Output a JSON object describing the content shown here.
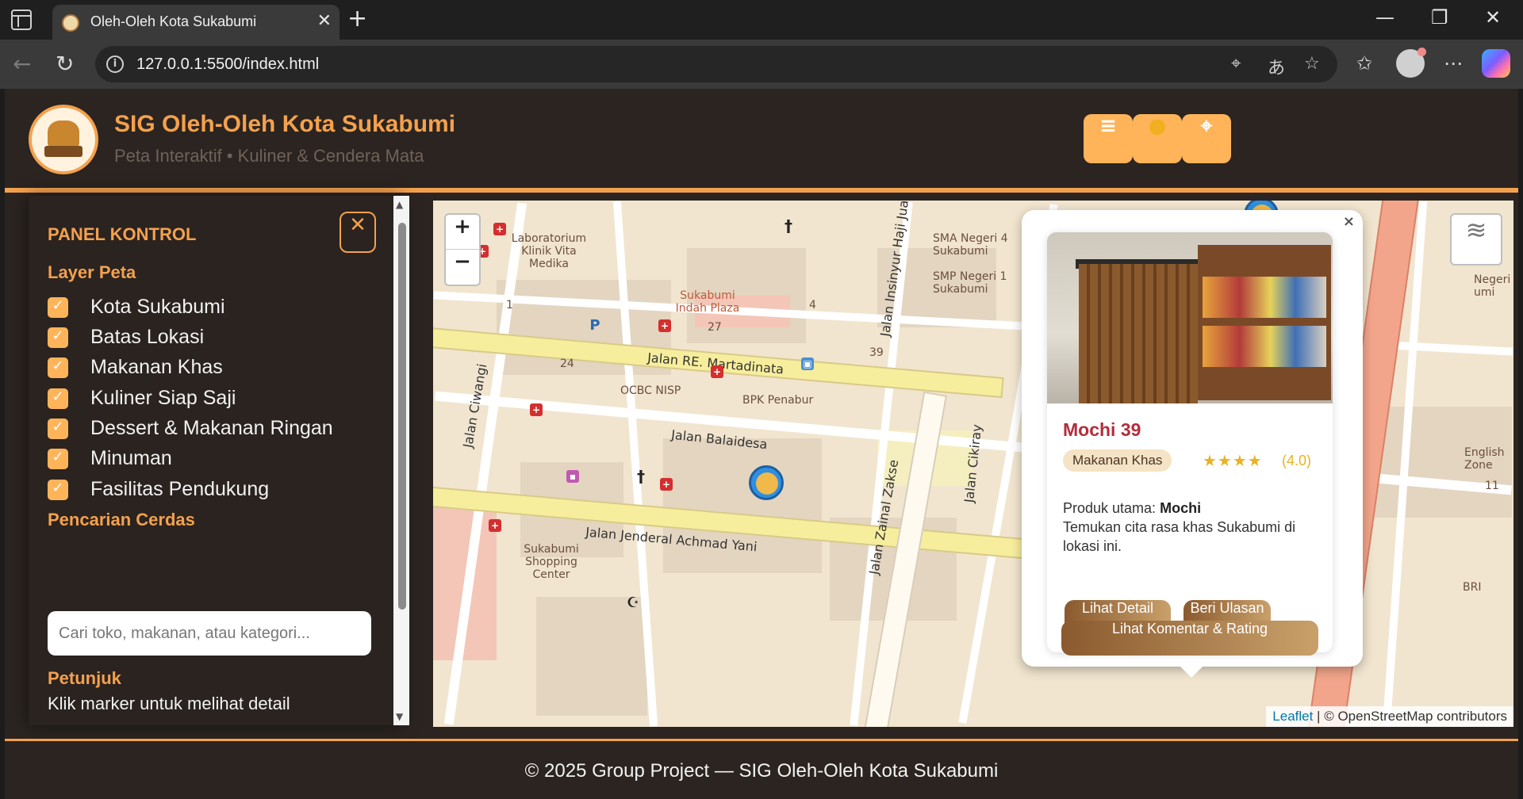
{
  "browser": {
    "tab_title": "Oleh-Oleh Kota Sukabumi",
    "tab_close": "✕",
    "new_tab": "+",
    "url": "127.0.0.1:5500/index.html",
    "window_controls": {
      "minimize": "—",
      "restore": "❐",
      "close": "✕"
    },
    "nav": {
      "back": "←",
      "reload": "↻",
      "info": "i"
    },
    "addr_icons": {
      "location": "⌖",
      "read_aloud": "あ",
      "favorite": "☆"
    },
    "toolbar_icons": {
      "favorites": "✩",
      "more": "⋯"
    }
  },
  "header": {
    "title": "SIG Oleh-Oleh Kota Sukabumi",
    "subtitle": "Peta Interaktif • Kuliner & Cendera Mata",
    "buttons": {
      "menu": "≡",
      "theme": "●",
      "locate": "⌖"
    }
  },
  "panel": {
    "title": "PANEL KONTROL",
    "close": "✕",
    "layer_heading": "Layer Peta",
    "layers": [
      {
        "label": "Kota Sukabumi",
        "checked": true
      },
      {
        "label": "Batas Lokasi",
        "checked": true
      },
      {
        "label": "Makanan Khas",
        "checked": true
      },
      {
        "label": "Kuliner Siap Saji",
        "checked": true
      },
      {
        "label": "Dessert & Makanan Ringan",
        "checked": true
      },
      {
        "label": "Minuman",
        "checked": true
      },
      {
        "label": "Fasilitas Pendukung",
        "checked": true
      }
    ],
    "check_mark": "✓",
    "search_heading": "Pencarian Cerdas",
    "search_placeholder": "Cari toko, makanan, atau kategori...",
    "hint_heading": "Petunjuk",
    "hint_text": "Klik marker untuk melihat detail"
  },
  "map": {
    "zoom_in": "+",
    "zoom_out": "−",
    "layers_icon": "≋",
    "streets": {
      "martadinata": "Jalan RE. Martadinata",
      "balaidesa": "Jalan Balaidesa",
      "ahmad_yani": "Jalan Jenderal Achmad Yani",
      "ciwangi": "Jalan Ciwangi",
      "zainal_zakse": "Jalan Zainal Zakse",
      "cikiray": "Jalan Cikiray",
      "insinyur": "Jalan Insinyur Haji Juanda"
    },
    "places": {
      "lab": "Laboratorium Klinik Vita Medika",
      "plaza": "Sukabumi Indah Plaza",
      "smp": "SMP Negeri 1 Sukabumi",
      "sma": "SMA Negeri 4 Sukabumi",
      "ocbc": "OCBC NISP",
      "bpk": "BPK Penabur",
      "mall": "Sukabumi Shopping Center",
      "english": "English Zone",
      "negeri": "Negeri umi",
      "bri": "BRI"
    },
    "house_numbers": [
      "24",
      "27",
      "39",
      "4",
      "1",
      "11"
    ],
    "attribution": {
      "leaflet": "Leaflet",
      "osm": " | © OpenStreetMap contributors"
    }
  },
  "popup": {
    "close": "×",
    "name": "Mochi 39",
    "category": "Makanan Khas",
    "stars": "★★★★",
    "rating_value": 4.0,
    "rating_text": "(4.0)",
    "product_label": "Produk utama:",
    "product_value": "Mochi",
    "description": "Temukan cita rasa khas Sukabumi di lokasi ini.",
    "btn_detail": "Lihat Detail",
    "btn_review": "Beri Ulasan",
    "btn_comments": "Lihat Komentar & Rating"
  },
  "footer": {
    "text": "© 2025 Group Project — SIG Oleh-Oleh Kota Sukabumi"
  }
}
